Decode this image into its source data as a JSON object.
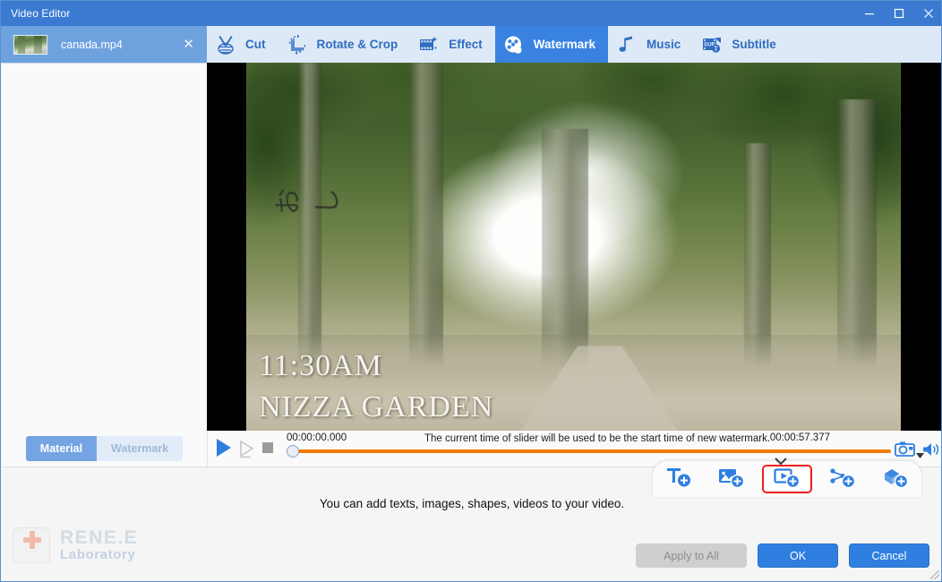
{
  "window": {
    "title": "Video Editor",
    "controls": [
      {
        "name": "minimize-button",
        "glyph": "minimize"
      },
      {
        "name": "maximize-button",
        "glyph": "maximize"
      },
      {
        "name": "close-button",
        "glyph": "close"
      }
    ]
  },
  "file_tab": {
    "name": "canada.mp4",
    "close_label": "✕"
  },
  "menu_tabs": [
    {
      "id": "cut",
      "label": "Cut",
      "icon": "scissors-icon",
      "active": false
    },
    {
      "id": "rotate-crop",
      "label": "Rotate & Crop",
      "icon": "rotate-crop-icon",
      "active": false
    },
    {
      "id": "effect",
      "label": "Effect",
      "icon": "effect-film-icon",
      "active": false
    },
    {
      "id": "watermark",
      "label": "Watermark",
      "icon": "watermark-icon",
      "active": true
    },
    {
      "id": "music",
      "label": "Music",
      "icon": "music-note-icon",
      "active": false
    },
    {
      "id": "subtitle",
      "label": "Subtitle",
      "icon": "subtitle-icon",
      "active": false
    }
  ],
  "left_panel": {
    "segments": [
      {
        "id": "material",
        "label": "Material",
        "active": true
      },
      {
        "id": "watermark",
        "label": "Watermark",
        "active": false
      }
    ]
  },
  "video": {
    "overlay_time": "11:30AM",
    "overlay_place": "NIZZA GARDEN",
    "graffiti": "おし"
  },
  "watermark_toolbar": {
    "buttons": [
      {
        "id": "add-text",
        "icon": "add-text-icon",
        "highlighted": false
      },
      {
        "id": "add-image",
        "icon": "add-image-icon",
        "highlighted": false
      },
      {
        "id": "add-video",
        "icon": "add-video-icon",
        "highlighted": true
      },
      {
        "id": "add-shape",
        "icon": "add-shape-icon",
        "highlighted": false
      },
      {
        "id": "add-object",
        "icon": "add-object-icon",
        "highlighted": false
      }
    ],
    "collapse_icon": "chevron-down-icon"
  },
  "transport": {
    "start_time": "00:00:00.000",
    "end_time": "00:00:57.377",
    "hint": "The current time of slider will be used to be the start time of new watermark.",
    "progress_percent": 0,
    "progress_color": "#f07c00",
    "play_icon": "play-icon",
    "frame_icon": "step-frame-icon",
    "stop_icon": "stop-icon",
    "snapshot_icon": "camera-icon",
    "snapshot_caret_icon": "caret-down-icon",
    "volume_icon": "volume-icon"
  },
  "bottom": {
    "hint": "You can add texts, images, shapes, videos to your video.",
    "brand_line1": "RENE.E",
    "brand_line2": "Laboratory",
    "buttons": [
      {
        "id": "apply-to-all",
        "label": "Apply to All",
        "style": "disabled"
      },
      {
        "id": "ok",
        "label": "OK",
        "style": "primary"
      },
      {
        "id": "cancel",
        "label": "Cancel",
        "style": "primary"
      }
    ]
  },
  "colors": {
    "titlebar": "#3a7ad1",
    "tabstrip": "#6ea2df",
    "menu_bg": "#dde9f7",
    "accent_blue": "#2f7fe0",
    "highlight_red": "#f01d1d",
    "timeline_orange": "#f07c00"
  }
}
